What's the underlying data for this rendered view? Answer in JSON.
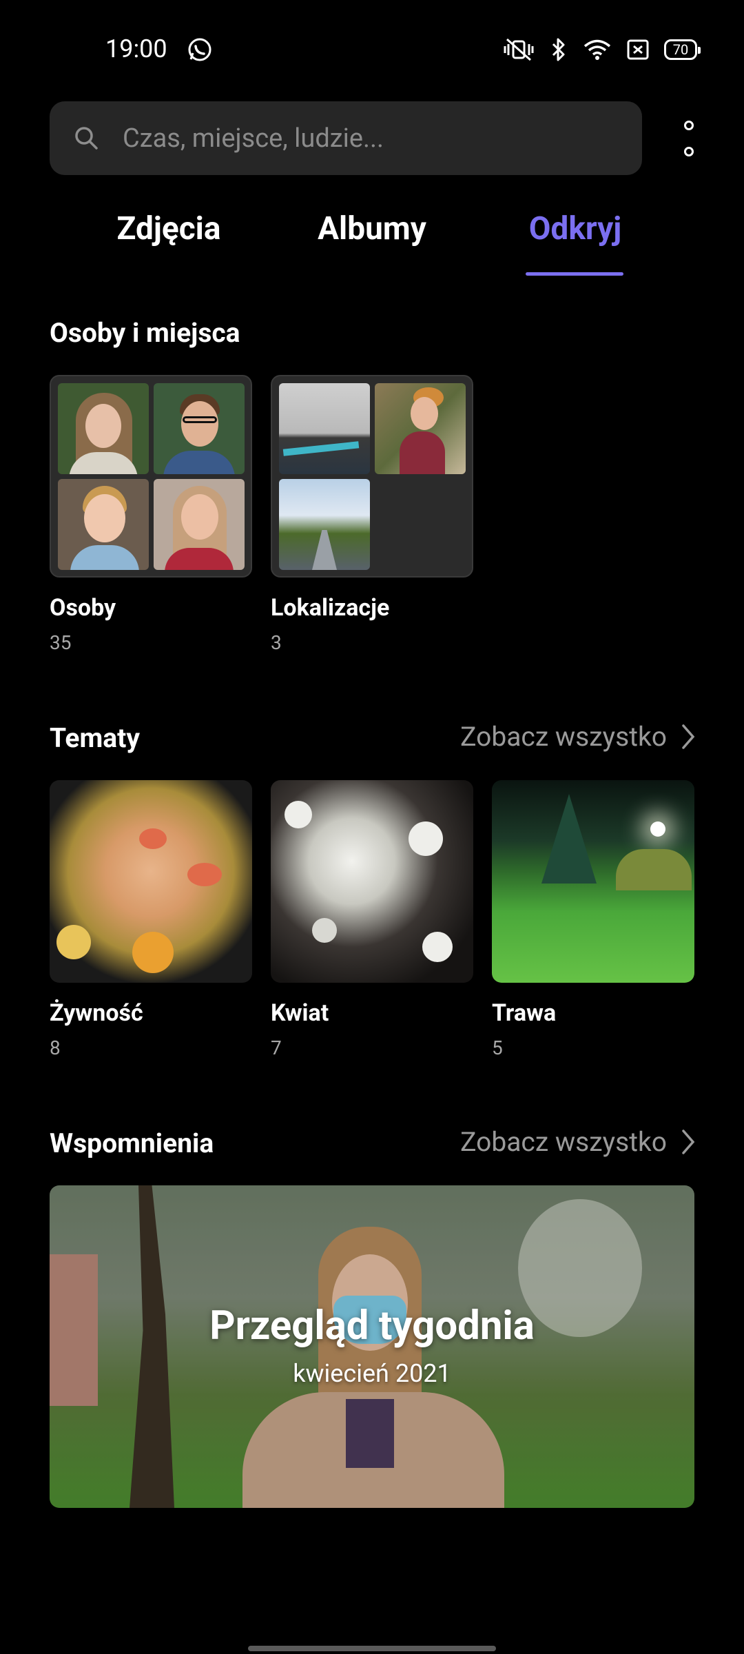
{
  "status": {
    "time": "19:00",
    "battery": "70",
    "icons": [
      "whatsapp-icon",
      "vibrate-off-icon",
      "bluetooth-icon",
      "wifi-icon",
      "no-sim-icon",
      "battery-icon"
    ]
  },
  "search": {
    "placeholder": "Czas, miejsce, ludzie..."
  },
  "tabs": [
    {
      "label": "Zdjęcia",
      "active": false
    },
    {
      "label": "Albumy",
      "active": false
    },
    {
      "label": "Odkryj",
      "active": true
    }
  ],
  "accent": "#7b6ff0",
  "people_places": {
    "title": "Osoby i miejsca",
    "items": [
      {
        "label": "Osoby",
        "count": "35"
      },
      {
        "label": "Lokalizacje",
        "count": "3"
      }
    ]
  },
  "topics": {
    "title": "Tematy",
    "see_all": "Zobacz wszystko",
    "items": [
      {
        "label": "Żywność",
        "count": "8"
      },
      {
        "label": "Kwiat",
        "count": "7"
      },
      {
        "label": "Trawa",
        "count": "5"
      }
    ]
  },
  "memories": {
    "title": "Wspomnienia",
    "see_all": "Zobacz wszystko",
    "card_title": "Przegląd tygodnia",
    "card_subtitle": "kwiecień 2021"
  }
}
